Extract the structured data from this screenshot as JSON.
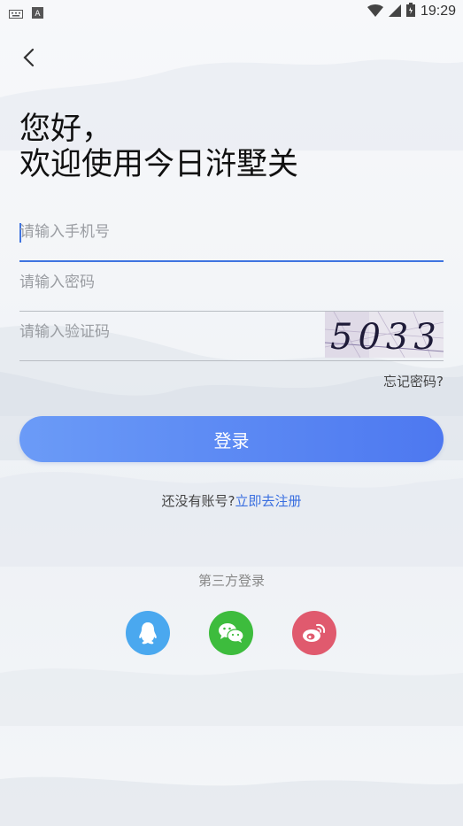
{
  "status_bar": {
    "time": "19:29"
  },
  "greeting": {
    "line1": "您好，",
    "line2": "欢迎使用今日浒墅关"
  },
  "form": {
    "phone_placeholder": "请输入手机号",
    "password_placeholder": "请输入密码",
    "captcha_placeholder": "请输入验证码",
    "captcha_text": "5033",
    "forgot_label": "忘记密码?",
    "login_label": "登录"
  },
  "register": {
    "prompt": "还没有账号?",
    "link": "立即去注册"
  },
  "third_party": {
    "title": "第三方登录",
    "providers": [
      {
        "name": "qq-icon",
        "color": "#4aa8ef"
      },
      {
        "name": "wechat-icon",
        "color": "#3dbc3d"
      },
      {
        "name": "weibo-icon",
        "color": "#e05a6e"
      }
    ]
  },
  "colors": {
    "accent": "#3f74e0",
    "link": "#3a6fe0"
  }
}
